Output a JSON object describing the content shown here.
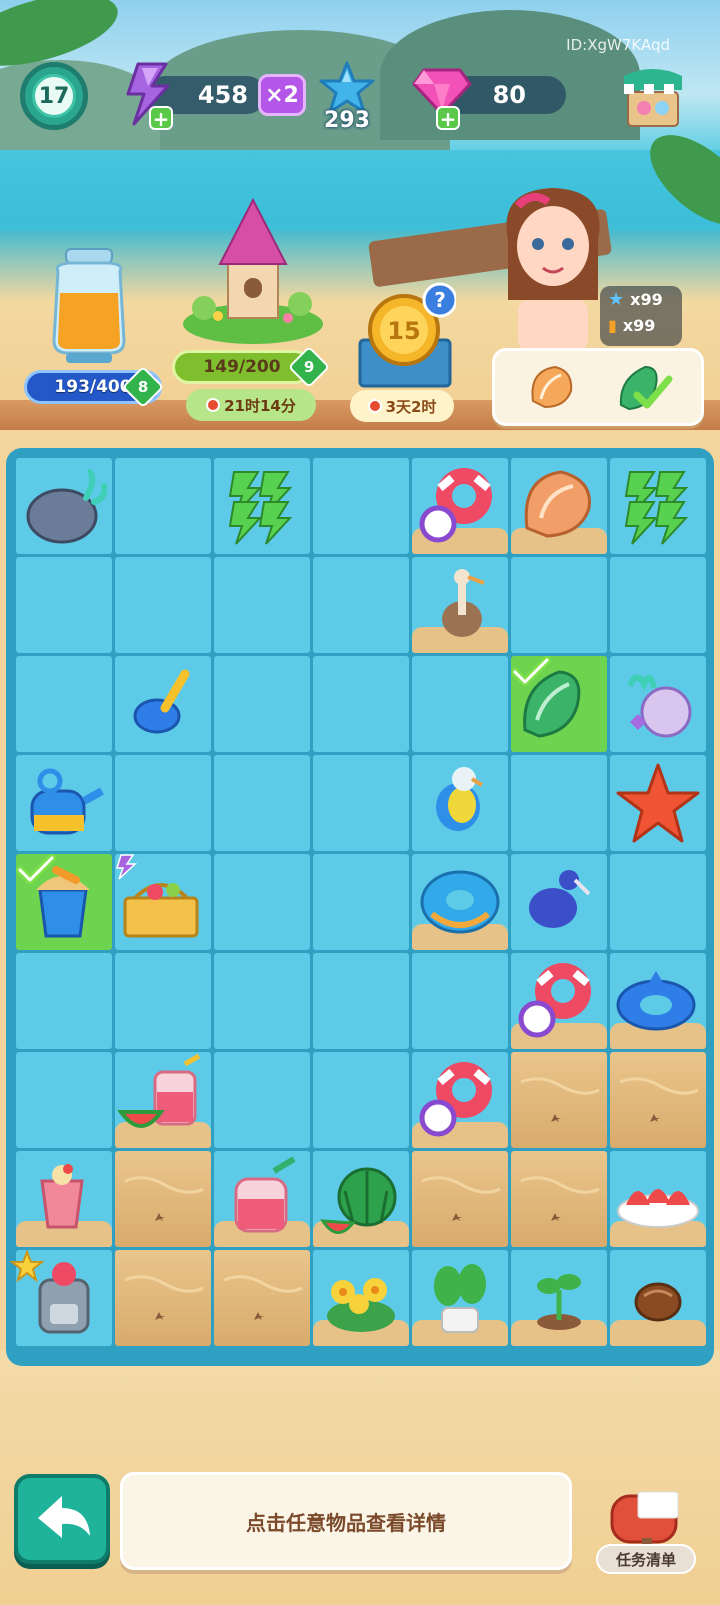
{
  "player_id": "ID:XgW7KAqd",
  "hud": {
    "level": "17",
    "energy": "458",
    "energy_multiplier": "×2",
    "stars": "293",
    "gems": "80"
  },
  "events": {
    "jar_progress": "193/400",
    "jar_level": "8",
    "tower_progress": "149/200",
    "tower_level": "9",
    "tower_timer": "21时14分",
    "coin_value": "15",
    "coin_timer": "3天2时",
    "star_boost_count": "x99",
    "drink_boost_count": "x99"
  },
  "board": {
    "rows": [
      [
        {
          "item": "rock-coral"
        },
        {
          "item": "empty"
        },
        {
          "item": "energy-bolts"
        },
        {
          "item": "empty"
        },
        {
          "item": "swim-ring-ball",
          "sand": true
        },
        {
          "item": "conch-shell",
          "sand": true
        },
        {
          "item": "energy-bolts"
        }
      ],
      [
        {
          "item": "empty"
        },
        {
          "item": "empty"
        },
        {
          "item": "empty"
        },
        {
          "item": "empty"
        },
        {
          "item": "pelican",
          "sand": true
        },
        {
          "item": "empty"
        },
        {
          "item": "empty"
        }
      ],
      [
        {
          "item": "empty"
        },
        {
          "item": "shovel"
        },
        {
          "item": "empty"
        },
        {
          "item": "empty"
        },
        {
          "item": "empty"
        },
        {
          "item": "green-shell",
          "green": true,
          "check": true
        },
        {
          "item": "coral-shells"
        }
      ],
      [
        {
          "item": "watering-can"
        },
        {
          "item": "empty"
        },
        {
          "item": "empty"
        },
        {
          "item": "empty"
        },
        {
          "item": "parrot"
        },
        {
          "item": "empty"
        },
        {
          "item": "starfish"
        }
      ],
      [
        {
          "item": "sand-bucket",
          "green": true,
          "check": true
        },
        {
          "item": "picnic-basket",
          "bolt": true
        },
        {
          "item": "empty"
        },
        {
          "item": "empty"
        },
        {
          "item": "donut-ring",
          "sand": true
        },
        {
          "item": "blue-bird"
        },
        {
          "item": "empty"
        }
      ],
      [
        {
          "item": "empty"
        },
        {
          "item": "empty"
        },
        {
          "item": "empty"
        },
        {
          "item": "empty"
        },
        {
          "item": "empty"
        },
        {
          "item": "swim-ring-ball",
          "sand": true
        },
        {
          "item": "shark-float",
          "sand": true
        }
      ],
      [
        {
          "item": "empty"
        },
        {
          "item": "watermelon-juice",
          "sand": true
        },
        {
          "item": "empty"
        },
        {
          "item": "empty"
        },
        {
          "item": "swim-ring-ball",
          "sand": true
        },
        {
          "item": "sand-tile"
        },
        {
          "item": "sand-tile"
        }
      ],
      [
        {
          "item": "fruit-cup",
          "sand": true
        },
        {
          "item": "sand-tile"
        },
        {
          "item": "juice-pitcher",
          "sand": true
        },
        {
          "item": "watermelon",
          "sand": true
        },
        {
          "item": "sand-tile"
        },
        {
          "item": "sand-tile"
        },
        {
          "item": "watermelon-slices",
          "sand": true
        }
      ],
      [
        {
          "item": "juicer-machine",
          "star": true
        },
        {
          "item": "sand-tile"
        },
        {
          "item": "sand-tile"
        },
        {
          "item": "yellow-flowers",
          "sand": true
        },
        {
          "item": "potted-plant",
          "sand": true
        },
        {
          "item": "sprout",
          "sand": true
        },
        {
          "item": "seed",
          "sand": true
        }
      ]
    ]
  },
  "bottom": {
    "hint": "点击任意物品查看详情",
    "task_list": "任务清单"
  },
  "colors": {
    "board_bg": "#2f9fc2",
    "cell": "#5dcbe8",
    "highlight": "#6ed44f",
    "sand": "#e2b97e",
    "accent_teal": "#1eb39a"
  }
}
